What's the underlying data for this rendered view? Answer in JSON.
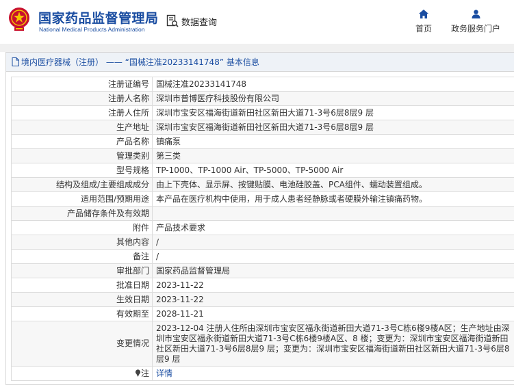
{
  "header": {
    "org_cn": "国家药品监督管理局",
    "org_en": "National Medical Products Administration",
    "data_query": "数据查询",
    "nav_home": "首页",
    "nav_portal": "政务服务门户",
    "brand_color": "#1a4da1",
    "emblem_color": "#c8102e"
  },
  "breadcrumb": {
    "text": "境内医疗器械（注册） —— “国械注准20233141748” 基本信息"
  },
  "record": [
    {
      "label": "注册证编号",
      "value": "国械注准20233141748"
    },
    {
      "label": "注册人名称",
      "value": "深圳市普博医疗科技股份有限公司"
    },
    {
      "label": "注册人住所",
      "value": "深圳市宝安区福海街道新田社区新田大道71-3号6层8层9 层"
    },
    {
      "label": "生产地址",
      "value": "深圳市宝安区福海街道新田社区新田大道71-3号6层8层9 层"
    },
    {
      "label": "产品名称",
      "value": "镇痛泵"
    },
    {
      "label": "管理类别",
      "value": "第三类"
    },
    {
      "label": "型号规格",
      "value": "TP-1000、TP-1000 Air、TP-5000、TP-5000 Air"
    },
    {
      "label": "结构及组成/主要组成成分",
      "value": "由上下壳体、显示屏、按键贴膜、电池硅胶盖、PCA组件、蠕动装置组成。"
    },
    {
      "label": "适用范围/预期用途",
      "value": "本产品在医疗机构中使用，用于成人患者经静脉或者硬膜外输注镇痛药物。"
    },
    {
      "label": "产品储存条件及有效期",
      "value": ""
    },
    {
      "label": "附件",
      "value": "产品技术要求"
    },
    {
      "label": "其他内容",
      "value": "/"
    },
    {
      "label": "备注",
      "value": "/"
    },
    {
      "label": "审批部门",
      "value": "国家药品监督管理局"
    },
    {
      "label": "批准日期",
      "value": "2023-11-22"
    },
    {
      "label": "生效日期",
      "value": "2023-11-22"
    },
    {
      "label": "有效期至",
      "value": "2028-11-21"
    },
    {
      "label": "变更情况",
      "value": "2023-12-04 注册人住所由深圳市宝安区福永街道新田大道71-3号C栋6楼9楼A区；生产地址由深圳市宝安区福永街道新田大道71-3号C栋6楼9楼A区、8 楼；变更为：深圳市宝安区福海街道新田社区新田大道71-3号6层8层9 层；变更为：深圳市宝安区福海街道新田社区新田大道71-3号6层8层9 层"
    }
  ],
  "note": {
    "label": "注",
    "link": "详情"
  }
}
